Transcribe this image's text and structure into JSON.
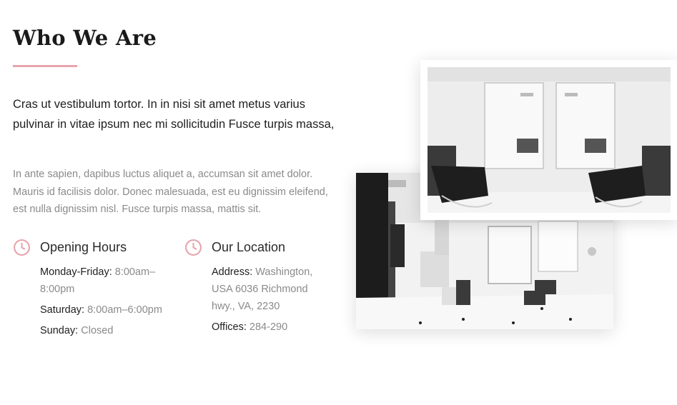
{
  "section": {
    "title": "Who We Are",
    "lead": "Cras ut vestibulum tortor. In in nisi sit amet metus varius pulvinar in vitae ipsum nec mi sollicitudin Fusce turpis massa,",
    "body": "In ante sapien, dapibus luctus aliquet a, accumsan sit amet dolor. Mauris id facilisis dolor. Donec malesuada, est eu dignissim eleifend, est nulla dignissim nisl. Fusce turpis massa, mattis sit."
  },
  "hours": {
    "title": "Opening Hours",
    "icon": "clock-icon",
    "items": [
      {
        "key": "Monday-Friday:",
        "value": "8:00am–8:00pm"
      },
      {
        "key": "Saturday:",
        "value": "8:00am–6:00pm"
      },
      {
        "key": "Sunday:",
        "value": "Closed"
      }
    ]
  },
  "location": {
    "title": "Our Location",
    "icon": "clock-icon",
    "items": [
      {
        "key": "Address:",
        "value": "Washington, USA 6036 Richmond hwy., VA, 2230"
      },
      {
        "key": "Offices:",
        "value": "284-290"
      }
    ]
  },
  "colors": {
    "accent": "#e8a4ad",
    "heading": "#1a1a1a",
    "muted": "#8a8a8a"
  }
}
